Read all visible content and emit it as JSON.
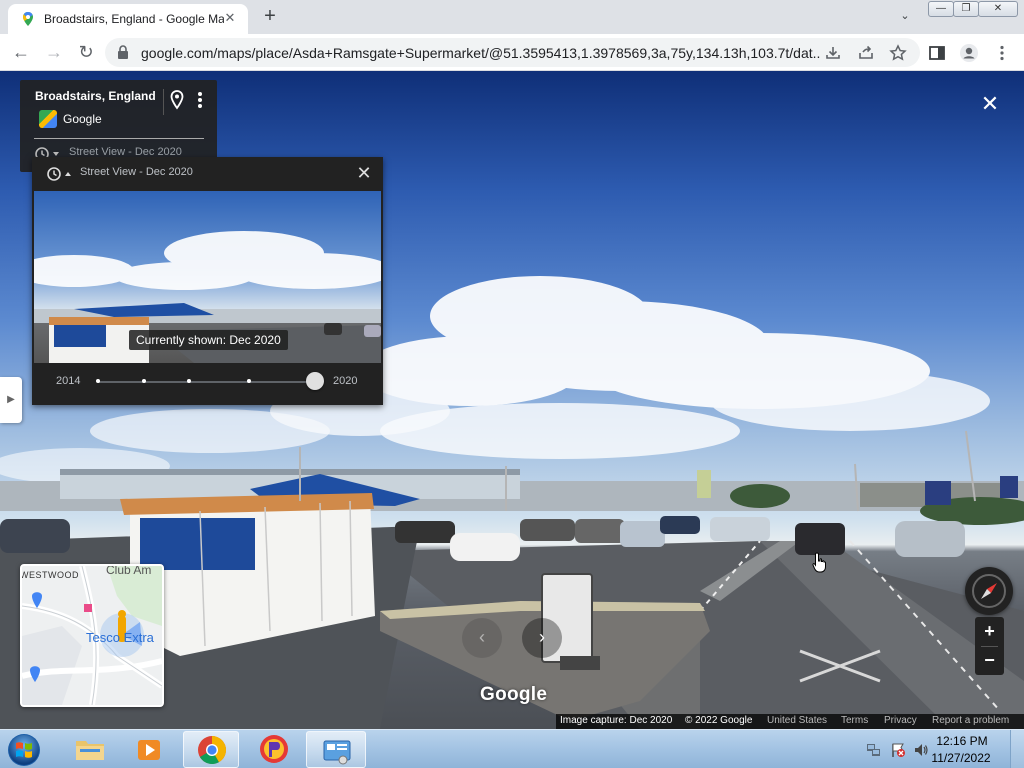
{
  "browser": {
    "tab_title": "Broadstairs, England - Google Maps",
    "tab_close": "✕",
    "new_tab": "+",
    "tab_menu": "⌄",
    "url": "google.com/maps/place/Asda+Ramsgate+Supermarket/@51.3595413,1.3978569,3a,75y,134.13h,103.7t/dat...",
    "window_minimize": "—",
    "window_restore": "❐",
    "window_close": "✕",
    "back": "←",
    "forward": "→",
    "reload": "↻"
  },
  "location_card": {
    "title": "Broadstairs, England",
    "provider": "Google",
    "street_view_label": "Street View - Dec 2020"
  },
  "time_machine": {
    "label": "Street View - Dec 2020",
    "close": "✕",
    "current_label": "Currently shown: Dec 2020",
    "year_start": "2014",
    "year_end": "2020",
    "selected_position": 1.0
  },
  "street_view": {
    "close": "✕",
    "prev_arrow": "‹",
    "next_arrow": "›",
    "watermark": "Google",
    "image_capture": "Image capture: Dec 2020",
    "copyright": "© 2022 Google",
    "region": "United States",
    "terms": "Terms",
    "privacy": "Privacy",
    "report": "Report a problem",
    "zoom_in": "+",
    "zoom_out": "−"
  },
  "minimap": {
    "label_westwood": "WESTWOOD",
    "label_club": "Club Am",
    "label_tesco": "Tesco Extra"
  },
  "taskbar": {
    "time": "12:16 PM",
    "date": "11/27/2022"
  },
  "icons": {
    "history": "history-icon",
    "pin": "pin-icon",
    "more": "more-vert-icon",
    "compass": "compass-icon"
  }
}
